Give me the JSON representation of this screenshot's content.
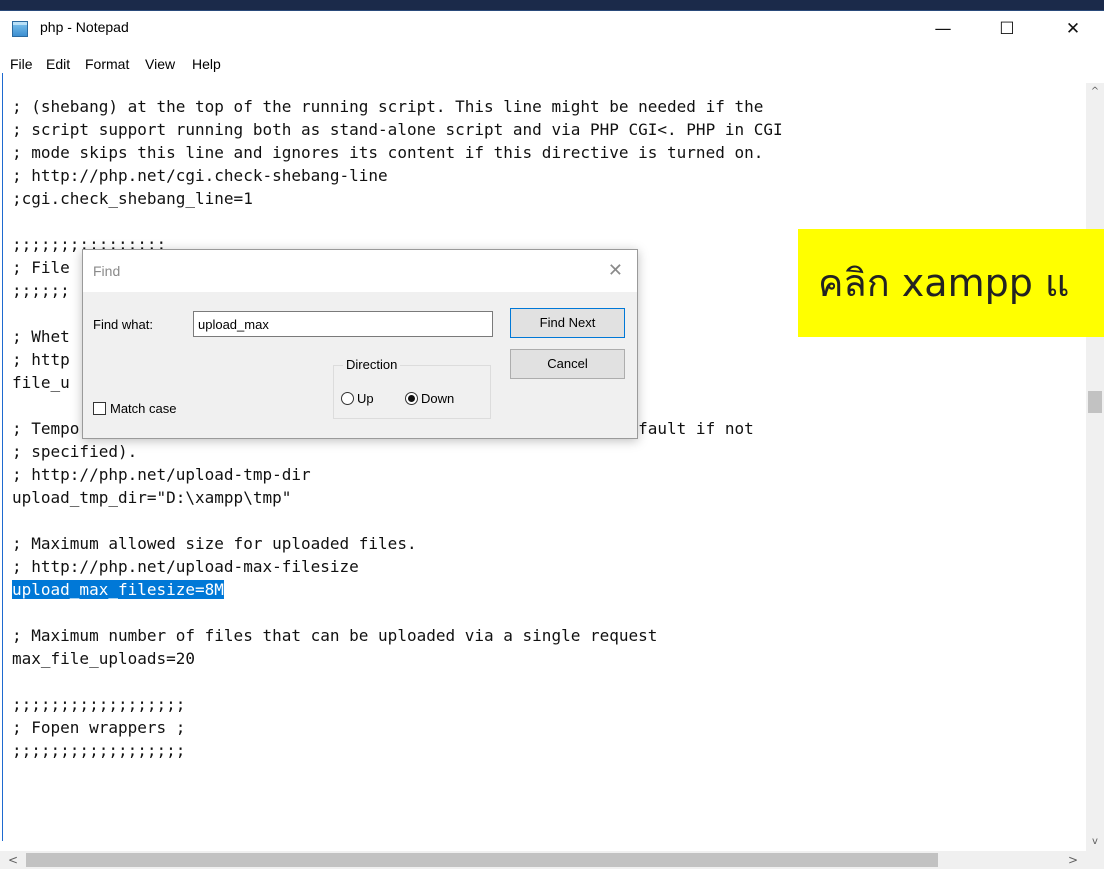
{
  "window": {
    "title": "php - Notepad",
    "minimize_glyph": "—",
    "maximize_glyph": "☐",
    "close_glyph": "✕"
  },
  "menu": {
    "items": [
      "File",
      "Edit",
      "Format",
      "View",
      "Help"
    ]
  },
  "editor": {
    "lines": [
      "; (shebang) at the top of the running script. This line might be needed if the",
      "; script support running both as stand-alone script and via PHP CGI<. PHP in CGI",
      "; mode skips this line and ignores its content if this directive is turned on.",
      "; http://php.net/cgi.check-shebang-line",
      ";cgi.check_shebang_line=1",
      "",
      ";;;;;;;;;;;;;;;;",
      "; File",
      ";;;;;;",
      "",
      "; Whet",
      "; http",
      "file_u",
      "",
      "; Temporary directory for HTTP uploaded files (will use system default if not",
      "; specified).",
      "; http://php.net/upload-tmp-dir",
      "upload_tmp_dir=\"D:\\xampp\\tmp\"",
      "",
      "; Maximum allowed size for uploaded files.",
      "; http://php.net/upload-max-filesize",
      "",
      "",
      "; Maximum number of files that can be uploaded via a single request",
      "max_file_uploads=20",
      "",
      ";;;;;;;;;;;;;;;;;;",
      "; Fopen wrappers ;",
      ";;;;;;;;;;;;;;;;;;"
    ],
    "highlighted_line": "upload_max_filesize=8M"
  },
  "find_dialog": {
    "title": "Find",
    "close_glyph": "✕",
    "find_what_label": "Find what:",
    "find_what_value": "upload_max",
    "find_next_label": "Find Next",
    "cancel_label": "Cancel",
    "direction_label": "Direction",
    "up_label": "Up",
    "down_label": "Down",
    "direction_selected": "Down",
    "match_case_label": "Match case",
    "match_case_checked": false
  },
  "annotation": {
    "text": "คลิก xampp แ"
  },
  "scrollbars": {
    "up_glyph": "^",
    "down_glyph": "v",
    "left_glyph": "<",
    "right_glyph": ">"
  }
}
